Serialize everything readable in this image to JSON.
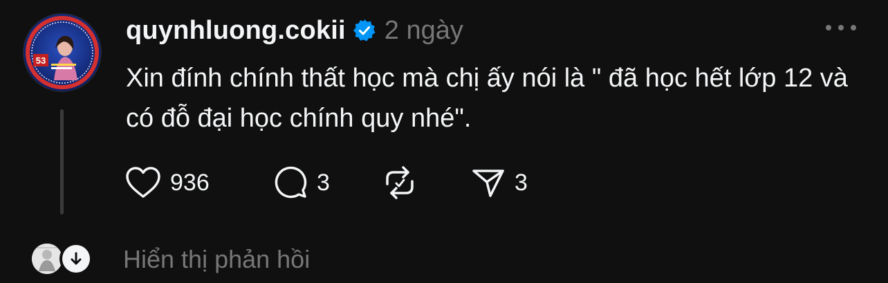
{
  "post": {
    "username": "quynhluong.cokii",
    "timestamp": "2 ngày",
    "text": "Xin đính chính thất học mà chị ấy nói là \" đã học hết lớp 12 và có đỗ đại học chính quy nhé\".",
    "verified_badge_icon": "verified-badge-icon",
    "more_icon": "more-options-icon",
    "avatar_badge_number": "53"
  },
  "actions": {
    "like_count": "936",
    "comment_count": "3",
    "repost_count": "",
    "share_count": "3"
  },
  "replies": {
    "label": "Hiển thị phản hồi"
  },
  "colors": {
    "background": "#101010",
    "text": "#f3f5f7",
    "muted": "#777777",
    "verified": "#0095f6"
  }
}
